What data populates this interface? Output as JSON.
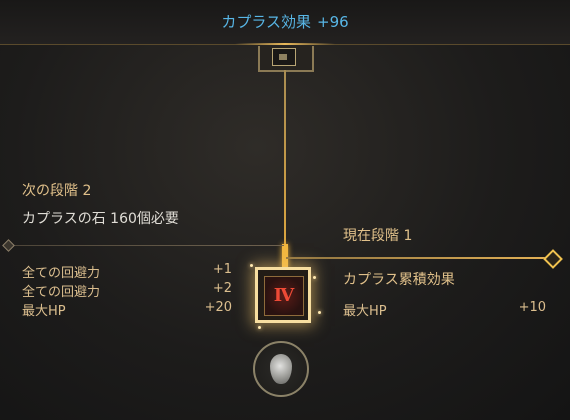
{
  "header": {
    "title": "カプラス効果",
    "bonus": "+96"
  },
  "next_stage": {
    "label": "次の段階 2",
    "requirement": "カプラスの石 160個必要",
    "stats": [
      {
        "name": "全ての回避力",
        "value": "+1"
      },
      {
        "name": "全ての回避力",
        "value": "+2"
      },
      {
        "name": "最大HP",
        "value": "+20"
      }
    ]
  },
  "current_stage": {
    "label": "現在段階 1",
    "cumulative_title": "カプラス累積効果",
    "stats": [
      {
        "name": "最大HP",
        "value": "+10"
      }
    ]
  },
  "stage_node": {
    "roman_numeral": "Ⅳ"
  },
  "colors": {
    "title_blue": "#58b6e6",
    "gold_text": "#e0c08a",
    "line_gold": "#e4b256",
    "roman_red": "#ee4a36"
  },
  "icons": [
    "top-node-icon",
    "caphras-stone-icon",
    "diamond-marker-icon"
  ]
}
